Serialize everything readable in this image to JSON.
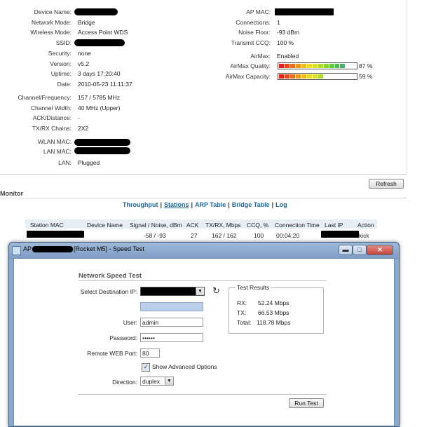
{
  "status": {
    "left": [
      {
        "label": "Device Name:",
        "value": ""
      },
      {
        "label": "Network Mode:",
        "value": "Bridge"
      },
      {
        "label": "Wireless Mode:",
        "value": "Access Point WDS"
      },
      {
        "label": "SSID:",
        "value": ""
      },
      {
        "label": "Security:",
        "value": "none"
      },
      {
        "label": "Version:",
        "value": "v5.2"
      },
      {
        "label": "Uptime:",
        "value": "3 days 17:20:40"
      },
      {
        "label": "Date:",
        "value": "2010-05-23 11:11:37"
      },
      {
        "label": "Channel/Frequency:",
        "value": "157 / 5785 MHz"
      },
      {
        "label": "Channel Width:",
        "value": "40 MHz (Upper)"
      },
      {
        "label": "ACK/Distance:",
        "value": "-"
      },
      {
        "label": "TX/RX Chains:",
        "value": "2X2"
      },
      {
        "label": "WLAN MAC:",
        "value": ""
      },
      {
        "label": "LAN MAC:",
        "value": ""
      },
      {
        "label": "LAN:",
        "value": "Plugged"
      }
    ],
    "right": [
      {
        "label": "AP MAC:",
        "value": ""
      },
      {
        "label": "Connections:",
        "value": "1"
      },
      {
        "label": "Noise Floor:",
        "value": "-93 dBm"
      },
      {
        "label": "Transmit CCQ:",
        "value": "100 %"
      },
      {
        "label": "AirMax:",
        "value": "Enabled"
      }
    ],
    "airmax_quality": {
      "label": "AirMax Quality:",
      "value": "87 %",
      "percent": 87
    },
    "airmax_capacity": {
      "label": "AirMax Capacity:",
      "value": "59 %",
      "percent": 59
    },
    "refresh_label": "Refresh"
  },
  "monitor": {
    "title": "Monitor",
    "tabs": [
      {
        "label": "Throughput",
        "active": false
      },
      {
        "label": "Stations",
        "active": true
      },
      {
        "label": "ARP Table",
        "active": false
      },
      {
        "label": "Bridge Table",
        "active": false
      },
      {
        "label": "Log",
        "active": false
      }
    ],
    "separator": "|",
    "columns": [
      "Station MAC",
      "Device Name",
      "Signal / Noise, dBm",
      "ACK",
      "TX/RX, Mbps",
      "CCQ, %",
      "Connection Time",
      "Last IP",
      "Action"
    ],
    "row": {
      "signal": "-58 / -93",
      "ack": "27",
      "txrx": "162 / 162",
      "ccq": "100",
      "conn_time": "00:04:20",
      "action": "kick"
    }
  },
  "dialog": {
    "title_prefix": "AP",
    "title_suffix": "[Rocket M5] - Speed Test",
    "section_title": "Network Speed Test",
    "dest_label": "Select Destination IP:",
    "user_label": "User:",
    "user_value": "admin",
    "password_label": "Password:",
    "password_value": "••••••",
    "port_label": "Remote WEB Port:",
    "port_value": "80",
    "advanced_label": "Show Advanced Options",
    "advanced_checked": true,
    "direction_label": "Direction:",
    "direction_value": "duplex",
    "results_title": "Test Results",
    "rx_label": "RX:",
    "rx_value": "52.24 Mbps",
    "tx_label": "TX:",
    "tx_value": "66.53 Mbps",
    "total_label": "Total:",
    "total_value": "118.78 Mbps",
    "run_label": "Run Test",
    "refresh_icon": "↻",
    "window_buttons": {
      "minimize": "▬",
      "maximize": "□",
      "close": "✕"
    }
  },
  "colors": {
    "link": "#1f6a9a",
    "title_blue": "#8aa9cf",
    "close_red": "#c8463a"
  }
}
